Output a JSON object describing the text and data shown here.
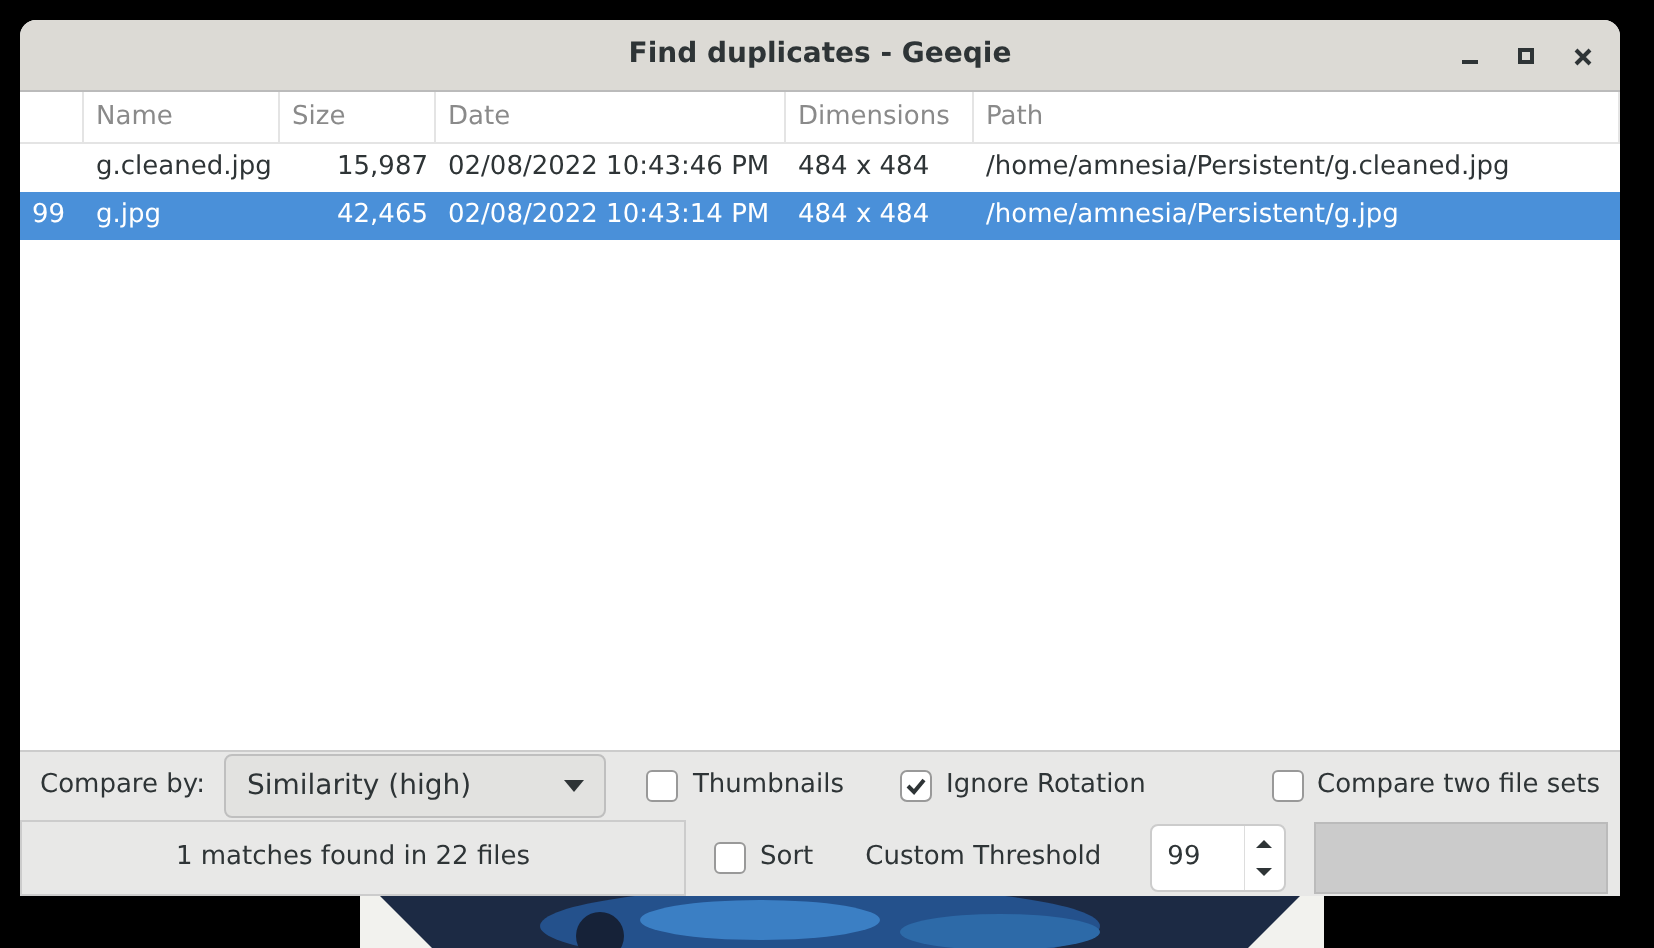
{
  "window": {
    "title": "Find duplicates - Geeqie"
  },
  "table": {
    "columns": [
      "Name",
      "Size",
      "Date",
      "Dimensions",
      "Path"
    ],
    "rows": [
      {
        "selected": false,
        "cells": [
          "g.cleaned.jpg",
          "15,987",
          "02/08/2022 10:43:46 PM",
          "484 x 484",
          "/home/amnesia/Persistent/g.cleaned.jpg"
        ]
      },
      {
        "selected": true,
        "similarity": "99",
        "cells": [
          "g.jpg",
          "42,465",
          "02/08/2022 10:43:14 PM",
          "484 x 484",
          "/home/amnesia/Persistent/g.jpg"
        ]
      }
    ]
  },
  "toolbar": {
    "compare_label": "Compare by:",
    "compare_value": "Similarity (high)",
    "checkboxes": [
      {
        "label": "Thumbnails",
        "checked": false
      },
      {
        "label": "Ignore Rotation",
        "checked": true
      },
      {
        "label": "Compare two file sets",
        "checked": false
      }
    ]
  },
  "status_bar": {
    "text": "1 matches found in 22 files",
    "sort": {
      "label": "Sort",
      "checked": false
    },
    "threshold_label": "Custom Threshold",
    "threshold_value": "99",
    "progress": {
      "level": 0
    }
  }
}
